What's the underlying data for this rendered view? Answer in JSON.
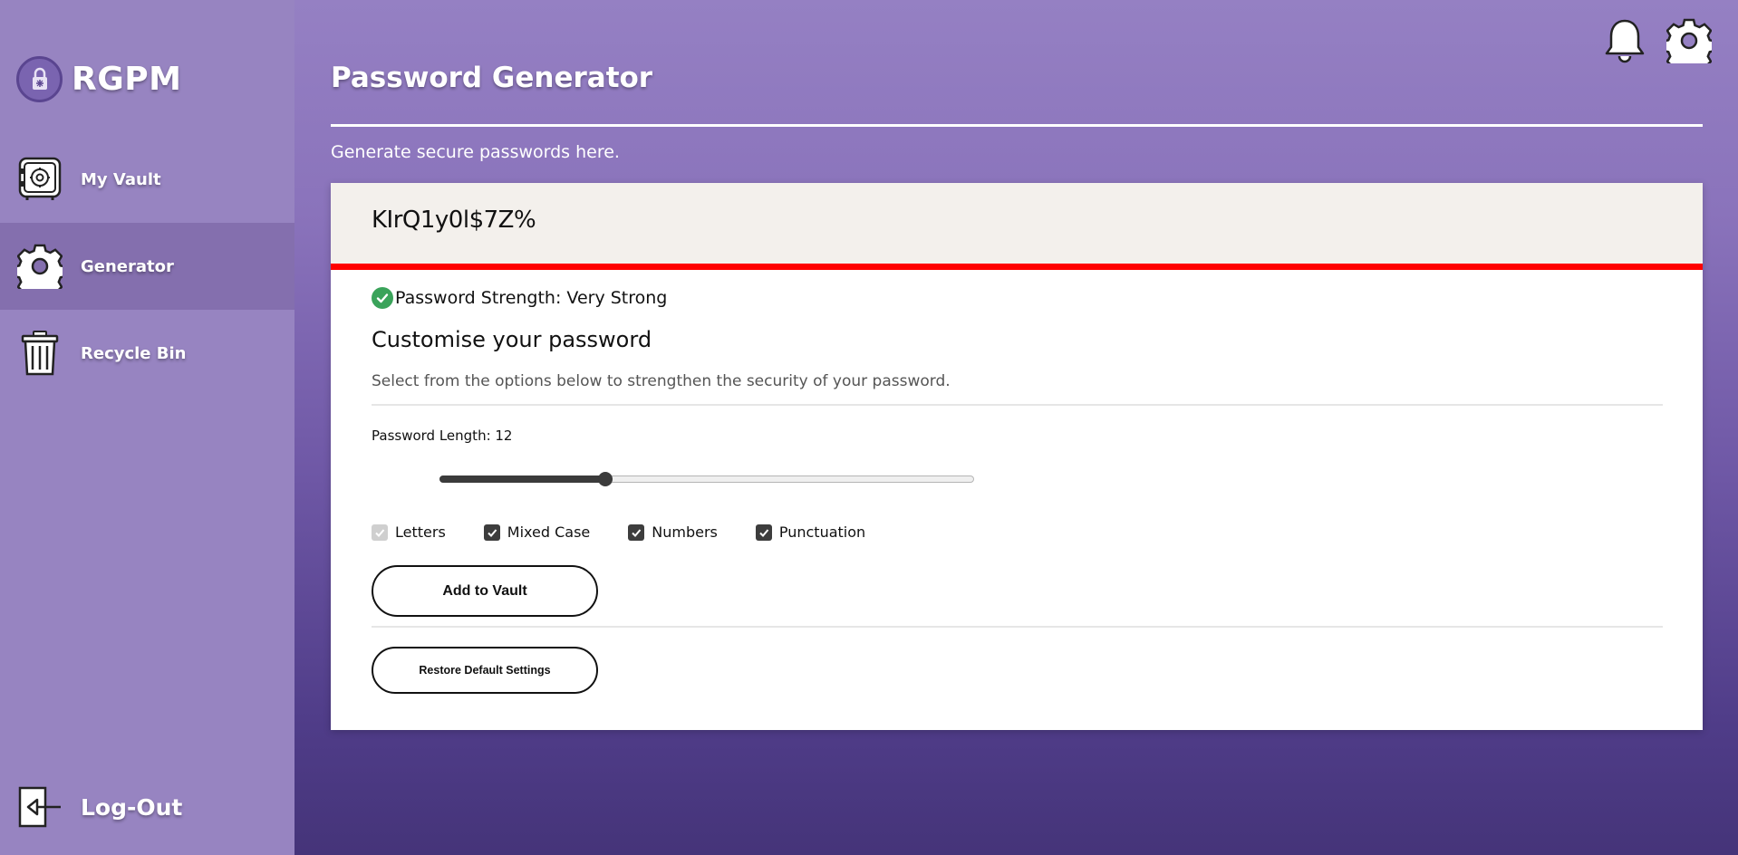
{
  "app": {
    "name": "RGPM"
  },
  "sidebar": {
    "items": [
      {
        "label": "My Vault",
        "icon": "vault-safe-icon"
      },
      {
        "label": "Generator",
        "icon": "gear-icon",
        "active": true
      },
      {
        "label": "Recycle Bin",
        "icon": "trash-bin-icon"
      }
    ],
    "logout_label": "Log-Out"
  },
  "header": {
    "icons": [
      "bell-icon",
      "gear-icon"
    ]
  },
  "main": {
    "title": "Password Generator",
    "subtitle": "Generate secure passwords here."
  },
  "generator": {
    "password": "KIrQ1y0l$7Z%",
    "strength_text": "Password Strength: Very Strong",
    "strength_bar_color": "#ff0000",
    "section_title": "Customise your password",
    "section_desc": "Select from the options below to strengthen the security of your password.",
    "length_label": "Password Length: 12",
    "length_value": 12,
    "length_fill_fraction": 0.31,
    "options": [
      {
        "label": "Letters",
        "checked": true,
        "disabled": true
      },
      {
        "label": "Mixed Case",
        "checked": true,
        "disabled": false
      },
      {
        "label": "Numbers",
        "checked": true,
        "disabled": false
      },
      {
        "label": "Punctuation",
        "checked": true,
        "disabled": false
      }
    ],
    "add_button": "Add to Vault",
    "restore_button": "Restore Default Settings"
  },
  "colors": {
    "sidebar_bg": "#9784c1",
    "active_item_bg": "#846fae",
    "success_green": "#3aa35a"
  }
}
